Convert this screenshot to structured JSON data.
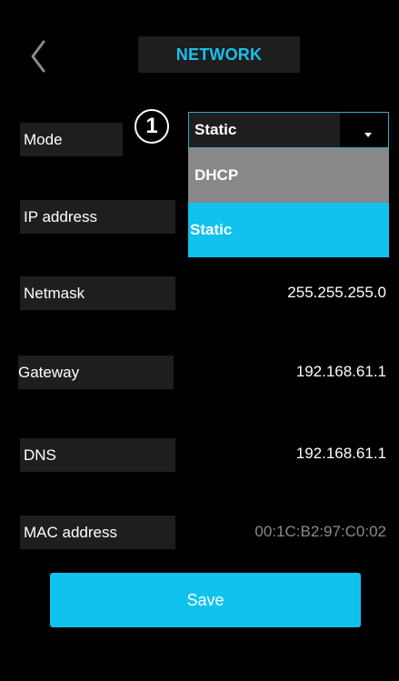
{
  "header": {
    "title": "NETWORK",
    "back_icon": "chevron-left-icon"
  },
  "step_badge": "1",
  "fields": {
    "mode": {
      "label": "Mode",
      "value": "Static"
    },
    "ip_address": {
      "label": "IP address"
    },
    "netmask": {
      "label": "Netmask",
      "value": "255.255.255.0"
    },
    "gateway": {
      "label": "Gateway",
      "value": "192.168.61.1"
    },
    "dns": {
      "label": "DNS",
      "value": "192.168.61.1"
    },
    "mac_address": {
      "label": "MAC address",
      "value": "00:1C:B2:97:C0:02"
    }
  },
  "mode_options": [
    "DHCP",
    "Static"
  ],
  "save_label": "Save",
  "colors": {
    "accent": "#10c2ec",
    "title_accent": "#1ac0ec",
    "background": "#000000",
    "field_bg": "#1e1e1e",
    "option_dhcp_bg": "#888888",
    "mac_value": "#8a8a8a"
  }
}
